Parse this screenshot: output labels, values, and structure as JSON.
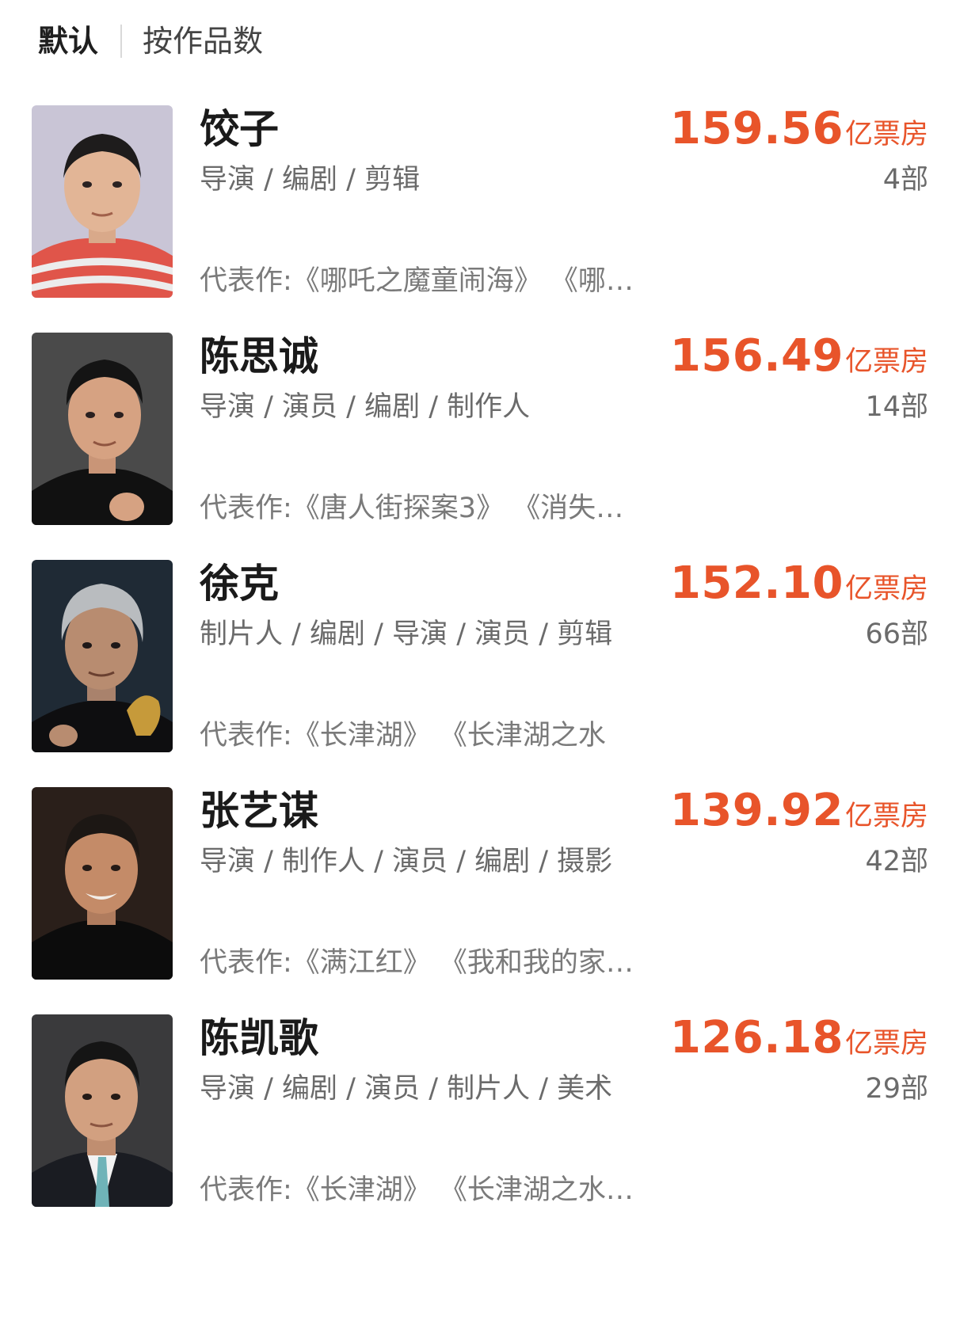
{
  "sort_tabs": [
    {
      "label": "默认",
      "active": true
    },
    {
      "label": "按作品数",
      "active": false
    }
  ],
  "box_unit": "亿票房",
  "works_prefix": "代表作:",
  "people": [
    {
      "name": "饺子",
      "roles": "导演 / 编剧 / 剪辑",
      "box_office": "159.56",
      "count": "4部",
      "works": "《哪吒之魔童闹海》 《哪…"
    },
    {
      "name": "陈思诚",
      "roles": "导演 / 演员 / 编剧 / 制作人",
      "box_office": "156.49",
      "count": "14部",
      "works": "《唐人街探案3》 《消失…"
    },
    {
      "name": "徐克",
      "roles": "制片人 / 编剧 / 导演 / 演员 / 剪辑",
      "box_office": "152.10",
      "count": "66部",
      "works": "《长津湖》 《长津湖之水"
    },
    {
      "name": "张艺谋",
      "roles": "导演 / 制作人 / 演员 / 编剧 / 摄影",
      "box_office": "139.92",
      "count": "42部",
      "works": "《满江红》 《我和我的家…"
    },
    {
      "name": "陈凯歌",
      "roles": "导演 / 编剧 / 演员 / 制片人 / 美术",
      "box_office": "126.18",
      "count": "29部",
      "works": "《长津湖》 《长津湖之水…"
    }
  ]
}
